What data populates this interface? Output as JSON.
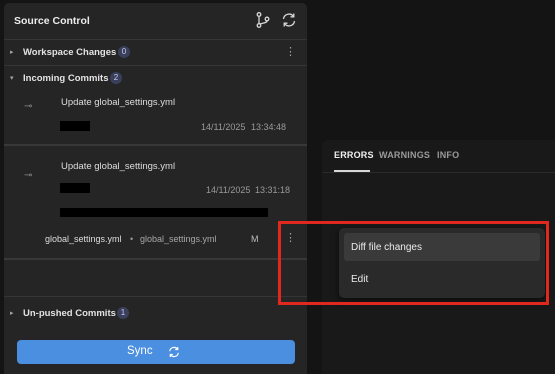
{
  "source_control": {
    "title": "Source Control",
    "icons": {
      "branch": "git-branch-icon",
      "refresh": "refresh-icon"
    },
    "sections": {
      "workspace_changes": {
        "label": "Workspace Changes",
        "count": "0"
      },
      "incoming_commits": {
        "label": "Incoming Commits",
        "count": "2"
      },
      "unpushed_commits": {
        "label": "Un-pushed Commits",
        "count": "1"
      }
    },
    "commits": [
      {
        "message": "Update global_settings.yml",
        "date": "14/11/2025",
        "time": "13:34:48"
      },
      {
        "message": "Update global_settings.yml",
        "date": "14/11/2025",
        "time": "13:31:18",
        "file": {
          "name": "global_settings.yml",
          "separator": "•",
          "path": "global_settings.yml",
          "status": "M"
        }
      }
    ],
    "commit_icon": "⊸",
    "kebab_glyph": "⋮",
    "sync": {
      "label": "Sync",
      "icon": "refresh-icon"
    }
  },
  "problems_panel": {
    "tabs": [
      {
        "label": "ERRORS",
        "active": true
      },
      {
        "label": "WARNINGS",
        "active": false
      },
      {
        "label": "INFO",
        "active": false
      }
    ]
  },
  "context_menu": {
    "items": [
      {
        "label": "Diff file changes",
        "hover": true
      },
      {
        "label": "Edit",
        "hover": false
      }
    ]
  },
  "colors": {
    "accent": "#4a8fe0",
    "highlight": "#e0281f",
    "badge": "#3a3f5c"
  }
}
